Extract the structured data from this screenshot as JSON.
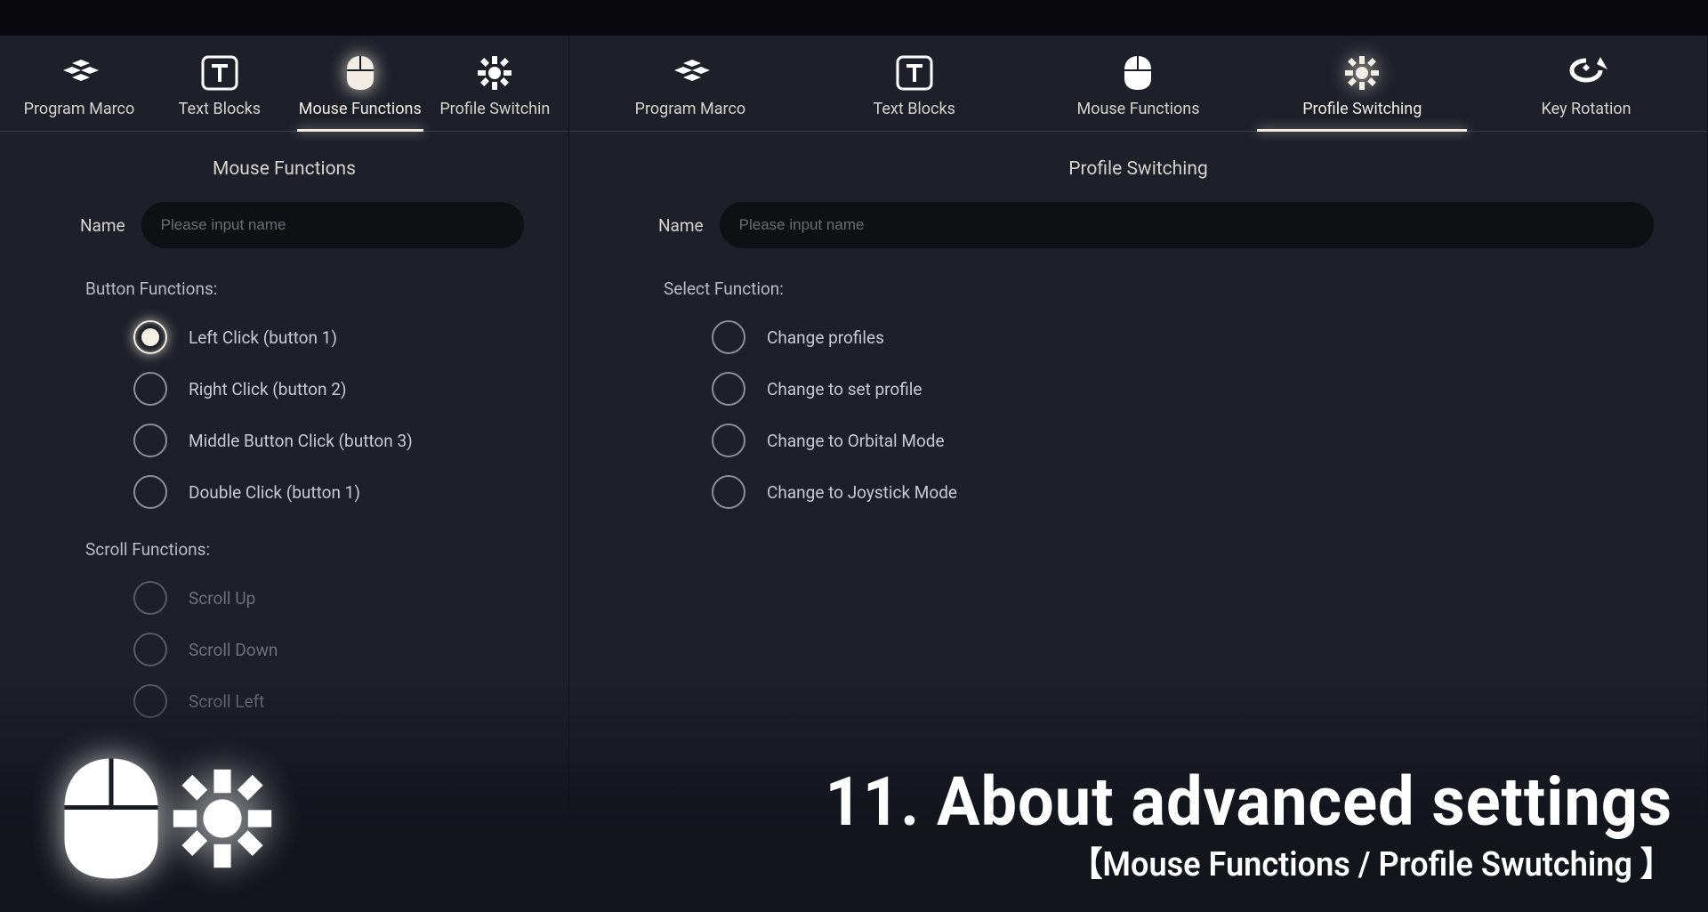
{
  "left": {
    "tabs": [
      {
        "label": "Program Marco"
      },
      {
        "label": "Text Blocks"
      },
      {
        "label": "Mouse Functions"
      },
      {
        "label": "Profile Switchin"
      }
    ],
    "title": "Mouse Functions",
    "name_label": "Name",
    "name_placeholder": "Please input name",
    "button_functions_label": "Button Functions:",
    "button_options": [
      "Left Click (button 1)",
      "Right Click (button 2)",
      "Middle Button Click (button 3)",
      "Double Click (button 1)"
    ],
    "scroll_functions_label": "Scroll Functions:",
    "scroll_options": [
      "Scroll Up",
      "Scroll Down",
      "Scroll Left"
    ]
  },
  "right": {
    "tabs": [
      {
        "label": "Program Marco"
      },
      {
        "label": "Text Blocks"
      },
      {
        "label": "Mouse Functions"
      },
      {
        "label": "Profile Switching"
      },
      {
        "label": "Key Rotation"
      }
    ],
    "title": "Profile Switching",
    "name_label": "Name",
    "name_placeholder": "Please input name",
    "select_function_label": "Select Function:",
    "options": [
      "Change profiles",
      "Change to set profile",
      "Change to Orbital Mode",
      "Change to Joystick Mode"
    ]
  },
  "overlay": {
    "title": "11. About advanced settings",
    "subtitle": "【Mouse Functions / Profile Swutching 】"
  }
}
